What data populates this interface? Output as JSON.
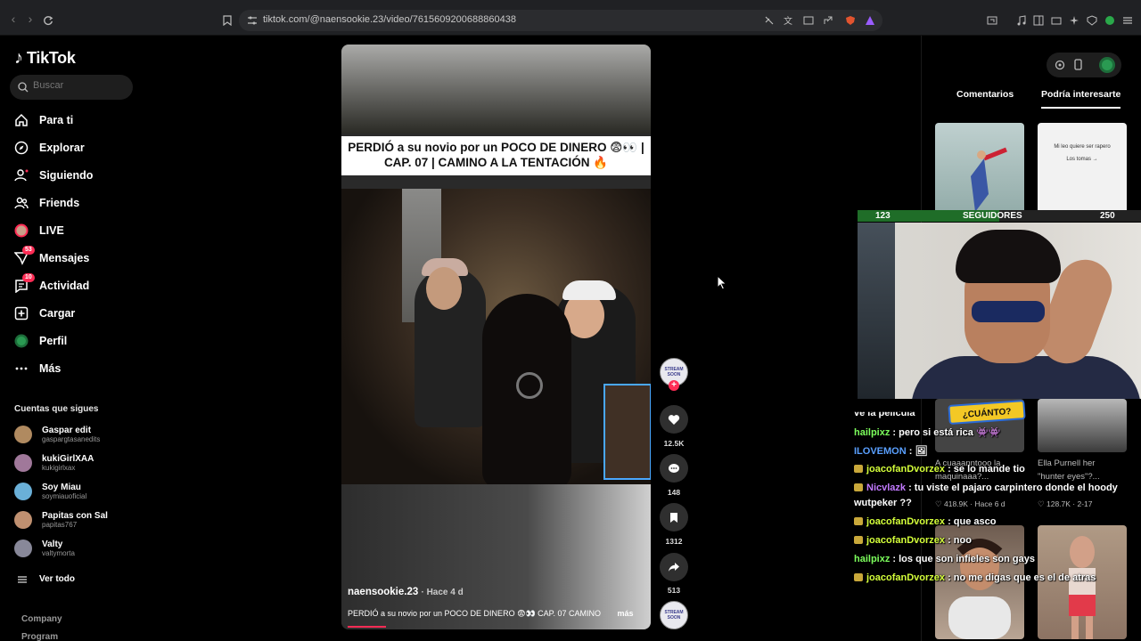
{
  "browser": {
    "url": "tiktok.com/@naensookie.23/video/7615609200688860438"
  },
  "sidebar": {
    "logo": "TikTok",
    "search_placeholder": "Buscar",
    "nav": [
      {
        "label": "Para ti",
        "icon": "home-icon"
      },
      {
        "label": "Explorar",
        "icon": "compass-icon"
      },
      {
        "label": "Siguiendo",
        "icon": "following-icon"
      },
      {
        "label": "Friends",
        "icon": "friends-icon"
      },
      {
        "label": "LIVE",
        "icon": "live-icon"
      },
      {
        "label": "Mensajes",
        "icon": "messages-icon",
        "badge": "53"
      },
      {
        "label": "Actividad",
        "icon": "activity-icon",
        "badge": "10"
      },
      {
        "label": "Cargar",
        "icon": "upload-icon"
      },
      {
        "label": "Perfil",
        "icon": "profile-icon"
      },
      {
        "label": "Más",
        "icon": "more-icon"
      }
    ],
    "following_title": "Cuentas que sigues",
    "following": [
      {
        "name": "Gaspar edit",
        "handle": "gaspargtasanedits",
        "color": "#b08a60"
      },
      {
        "name": "kukiGirlXAA",
        "handle": "kukigirlxax",
        "color": "#a0789a"
      },
      {
        "name": "Soy Miau",
        "handle": "soymiauoficial",
        "color": "#6ab0d8"
      },
      {
        "name": "Papitas con Sal",
        "handle": "papitas767",
        "color": "#c09070"
      },
      {
        "name": "Valty",
        "handle": "valtymorta",
        "color": "#888899"
      }
    ],
    "see_all": "Ver todo",
    "footer": [
      "Company",
      "Program"
    ]
  },
  "video": {
    "caption_line1": "PERDIÓ a su novio por un POCO DE DINERO 😨👀 |",
    "caption_line2": "CAP. 07 | CAMINO A LA TENTACIÓN 🔥",
    "author": "naensookie.23",
    "time_ago": "Hace 4 d",
    "description": "PERDIÓ a su novio por un POCO DE DINERO 😨👀 CAP. 07 CAMINO",
    "more": "más",
    "progress_percent": 13
  },
  "actions": {
    "creator_avatar_text": "STREAM SOON",
    "likes": "12.5K",
    "comments": "148",
    "saves": "1312",
    "shares": "513"
  },
  "right_panel": {
    "tabs": [
      "Comentarios",
      "Podría interesarte"
    ],
    "active_tab": 1,
    "thumb2_text": "Mi leo quiere ser rapero",
    "thumb2_sub": "Los tomas →",
    "under_thumbs": [
      {
        "title": "A cuaaanntooo la",
        "sub": "maquinaaa?...",
        "views": "418.9K",
        "date": "Hace 6 d"
      },
      {
        "title": "Ella Purnell her",
        "sub": "\"hunter eyes\"?...",
        "views": "128.7K",
        "date": "2-17"
      }
    ]
  },
  "stream": {
    "followers_current": "123",
    "followers_label": "SEGUIDORES",
    "followers_goal": "250",
    "progress_fraction": 0.5,
    "sticker_text": "¿CUÁNTO?",
    "chat": [
      {
        "user": "",
        "msg": "ve la pelicula",
        "color": "u-green",
        "badge": false,
        "partial": true
      },
      {
        "user": "hailpixz",
        "msg": " : pero si está rica 👾👾",
        "color": "u-green",
        "badge": false
      },
      {
        "user": "ILOVEMON",
        "msg": " : 🖼",
        "color": "u-blue",
        "badge": false
      },
      {
        "user": "joacofanDvorzex",
        "msg": " : se lo mande tio",
        "color": "u-yellow",
        "badge": true
      },
      {
        "user": "Nicvlazk",
        "msg": " : tu viste el pajaro carpintero donde el hoody",
        "color": "u-purple",
        "badge": true
      },
      {
        "user": "",
        "msg": "wutpeker ??",
        "color": "u-green",
        "badge": false
      },
      {
        "user": "joacofanDvorzex",
        "msg": " : que asco",
        "color": "u-yellow",
        "badge": true
      },
      {
        "user": "joacofanDvorzex",
        "msg": " : noo",
        "color": "u-yellow",
        "badge": true
      },
      {
        "user": "hailpixz",
        "msg": " : los que son infieles son gays",
        "color": "u-green",
        "badge": false
      },
      {
        "user": "joacofanDvorzex",
        "msg": " : no me digas que es el de atras",
        "color": "u-yellow",
        "badge": true
      }
    ]
  }
}
